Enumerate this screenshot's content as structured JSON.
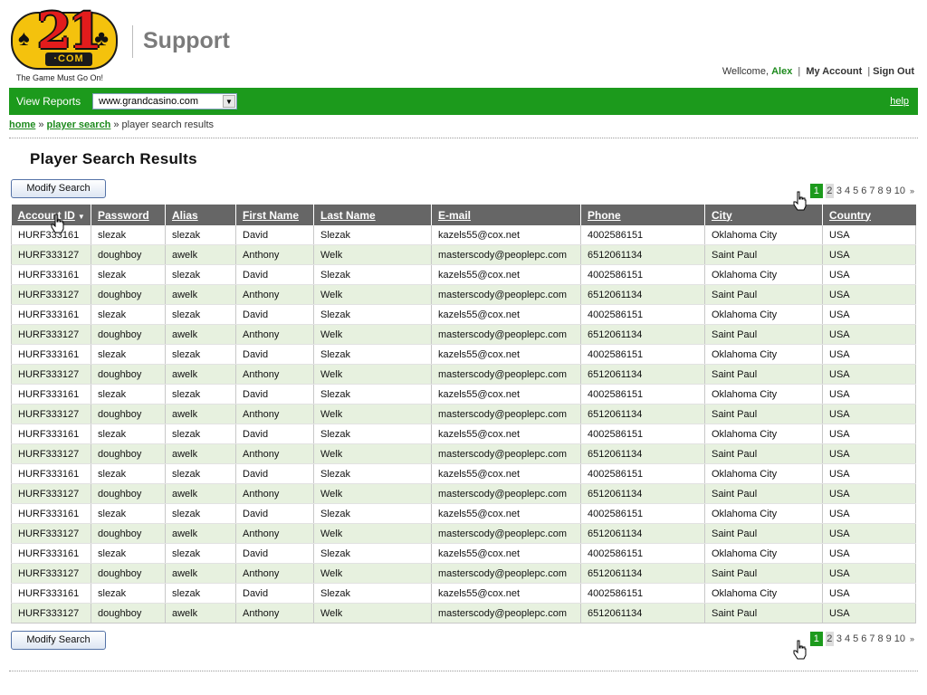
{
  "header": {
    "logo": {
      "number": "21",
      "domain": "·COM",
      "tagline": "The Game Must Go On!"
    },
    "title": "Support",
    "user_nav": {
      "welcome": "Wellcome,",
      "username": "Alex",
      "my_account": "My Account",
      "sign_out": "Sign Out"
    }
  },
  "reports_bar": {
    "label": "View Reports",
    "selected_site": "www.grandcasino.com",
    "help": "help"
  },
  "breadcrumb": {
    "home": "home",
    "player_search": "player search",
    "current": "player search results"
  },
  "page_title": "Player Search Results",
  "modify_button_label": "Modify Search",
  "pagination": {
    "current": "1",
    "pages": [
      "2",
      "3",
      "4",
      "5",
      "6",
      "7",
      "8",
      "9",
      "10"
    ],
    "next": "»"
  },
  "table": {
    "columns": [
      "Account ID",
      "Password",
      "Alias",
      "First Name",
      "Last Name",
      "E-mail",
      "Phone",
      "City",
      "Country"
    ],
    "sorted_column": "Account ID",
    "rows": [
      [
        "HURF333161",
        "slezak",
        "slezak",
        "David",
        "Slezak",
        "kazels55@cox.net",
        "4002586151",
        "Oklahoma City",
        "USA"
      ],
      [
        "HURF333127",
        "doughboy",
        "awelk",
        "Anthony",
        "Welk",
        "masterscody@peoplepc.com",
        "6512061134",
        "Saint Paul",
        "USA"
      ],
      [
        "HURF333161",
        "slezak",
        "slezak",
        "David",
        "Slezak",
        "kazels55@cox.net",
        "4002586151",
        "Oklahoma City",
        "USA"
      ],
      [
        "HURF333127",
        "doughboy",
        "awelk",
        "Anthony",
        "Welk",
        "masterscody@peoplepc.com",
        "6512061134",
        "Saint Paul",
        "USA"
      ],
      [
        "HURF333161",
        "slezak",
        "slezak",
        "David",
        "Slezak",
        "kazels55@cox.net",
        "4002586151",
        "Oklahoma City",
        "USA"
      ],
      [
        "HURF333127",
        "doughboy",
        "awelk",
        "Anthony",
        "Welk",
        "masterscody@peoplepc.com",
        "6512061134",
        "Saint Paul",
        "USA"
      ],
      [
        "HURF333161",
        "slezak",
        "slezak",
        "David",
        "Slezak",
        "kazels55@cox.net",
        "4002586151",
        "Oklahoma City",
        "USA"
      ],
      [
        "HURF333127",
        "doughboy",
        "awelk",
        "Anthony",
        "Welk",
        "masterscody@peoplepc.com",
        "6512061134",
        "Saint Paul",
        "USA"
      ],
      [
        "HURF333161",
        "slezak",
        "slezak",
        "David",
        "Slezak",
        "kazels55@cox.net",
        "4002586151",
        "Oklahoma City",
        "USA"
      ],
      [
        "HURF333127",
        "doughboy",
        "awelk",
        "Anthony",
        "Welk",
        "masterscody@peoplepc.com",
        "6512061134",
        "Saint Paul",
        "USA"
      ],
      [
        "HURF333161",
        "slezak",
        "slezak",
        "David",
        "Slezak",
        "kazels55@cox.net",
        "4002586151",
        "Oklahoma City",
        "USA"
      ],
      [
        "HURF333127",
        "doughboy",
        "awelk",
        "Anthony",
        "Welk",
        "masterscody@peoplepc.com",
        "6512061134",
        "Saint Paul",
        "USA"
      ],
      [
        "HURF333161",
        "slezak",
        "slezak",
        "David",
        "Slezak",
        "kazels55@cox.net",
        "4002586151",
        "Oklahoma City",
        "USA"
      ],
      [
        "HURF333127",
        "doughboy",
        "awelk",
        "Anthony",
        "Welk",
        "masterscody@peoplepc.com",
        "6512061134",
        "Saint Paul",
        "USA"
      ],
      [
        "HURF333161",
        "slezak",
        "slezak",
        "David",
        "Slezak",
        "kazels55@cox.net",
        "4002586151",
        "Oklahoma City",
        "USA"
      ],
      [
        "HURF333127",
        "doughboy",
        "awelk",
        "Anthony",
        "Welk",
        "masterscody@peoplepc.com",
        "6512061134",
        "Saint Paul",
        "USA"
      ],
      [
        "HURF333161",
        "slezak",
        "slezak",
        "David",
        "Slezak",
        "kazels55@cox.net",
        "4002586151",
        "Oklahoma City",
        "USA"
      ],
      [
        "HURF333127",
        "doughboy",
        "awelk",
        "Anthony",
        "Welk",
        "masterscody@peoplepc.com",
        "6512061134",
        "Saint Paul",
        "USA"
      ],
      [
        "HURF333161",
        "slezak",
        "slezak",
        "David",
        "Slezak",
        "kazels55@cox.net",
        "4002586151",
        "Oklahoma City",
        "USA"
      ],
      [
        "HURF333127",
        "doughboy",
        "awelk",
        "Anthony",
        "Welk",
        "masterscody@peoplepc.com",
        "6512061134",
        "Saint Paul",
        "USA"
      ]
    ]
  },
  "colors": {
    "brand_green": "#1c9a1c",
    "link_green": "#1d8a1d",
    "table_header": "#666666",
    "row_alt": "#e7f1df",
    "logo_yellow": "#f4c20d",
    "logo_red": "#e21c1c"
  },
  "icons": {
    "sort": "triangle-down-icon",
    "select_arrow": "chevron-down-icon",
    "cursor": "hand-pointer-icon"
  }
}
